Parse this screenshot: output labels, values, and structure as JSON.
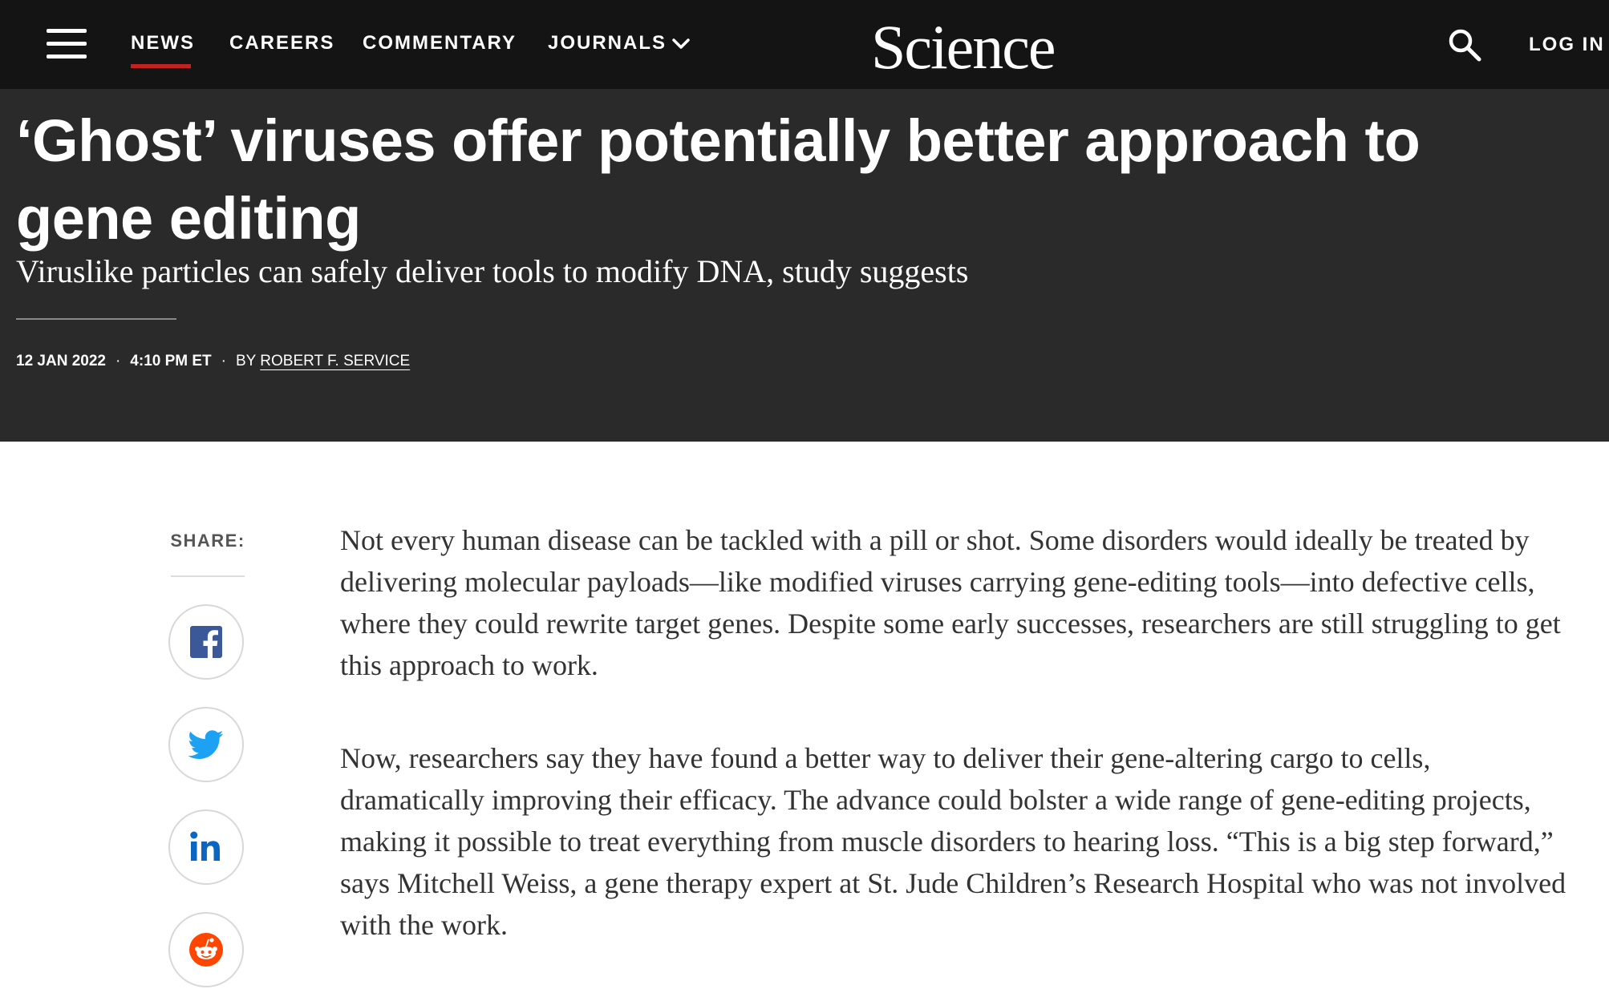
{
  "nav": {
    "items": [
      "NEWS",
      "CAREERS",
      "COMMENTARY",
      "JOURNALS"
    ],
    "active": "NEWS",
    "brand": "Science",
    "login": "LOG IN",
    "accent_color": "#c22220"
  },
  "article": {
    "headline": "‘Ghost’ viruses offer potentially better approach to gene editing",
    "deck": "Viruslike particles can safely deliver tools to modify DNA, study suggests",
    "date": "12 JAN 2022",
    "time": "4:10 PM ET",
    "by": "BY",
    "author": "ROBERT F. SERVICE",
    "paragraphs": [
      "Not every human disease can be tackled with a pill or shot. Some disorders would ideally be treated by delivering molecular payloads—like modified viruses carrying gene-editing tools—into defective cells, where they could rewrite target genes. Despite some early successes, researchers are still struggling to get this approach to work.",
      "Now, researchers say they have found a better way to deliver their gene-altering cargo to cells, dramatically improving their efficacy. The advance could bolster a wide range of gene-editing projects, making it possible to treat everything from muscle disorders to hearing loss. “This is a big step forward,” says Mitchell Weiss, a gene therapy expert at St. Jude Children’s Research Hospital who was not involved with the work."
    ]
  },
  "share": {
    "label": "SHARE:",
    "buttons": [
      {
        "icon": "facebook-icon",
        "color": "#3b5998"
      },
      {
        "icon": "twitter-icon",
        "color": "#1da1f2"
      },
      {
        "icon": "linkedin-icon",
        "color": "#0a66c2"
      },
      {
        "icon": "reddit-icon",
        "color": "#ff4500"
      }
    ]
  }
}
